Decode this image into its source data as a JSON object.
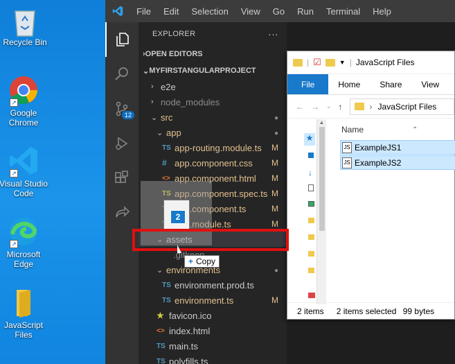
{
  "desktop": {
    "icons": [
      {
        "label": "Recycle Bin"
      },
      {
        "label": "Google Chrome"
      },
      {
        "label": "Visual Studio Code"
      },
      {
        "label": "Microsoft Edge"
      },
      {
        "label": "JavaScript Files"
      }
    ]
  },
  "vscode": {
    "menu": [
      "File",
      "Edit",
      "Selection",
      "View",
      "Go",
      "Run",
      "Terminal",
      "Help"
    ],
    "scm_badge": "12",
    "explorer_title": "EXPLORER",
    "more_actions": "···",
    "open_editors": "OPEN EDITORS",
    "project": "MYFIRSTANGULARPROJECT",
    "tree": {
      "e2e": "e2e",
      "node_modules": "node_modules",
      "src": "src",
      "app": "app",
      "app_routing": "app-routing.module.ts",
      "app_css": "app.component.css",
      "app_html": "app.component.html",
      "app_spec": "app.component.spec.ts",
      "app_ts": "app.component.ts",
      "app_module": "app.module.ts",
      "assets": "assets",
      "gitkeep": ".gitkeep",
      "environments": "environments",
      "env_prod": "environment.prod.ts",
      "env": "environment.ts",
      "favicon": "favicon.ico",
      "index": "index.html",
      "main": "main.ts",
      "polyfills": "polyfills.ts"
    },
    "modified_mark": "M"
  },
  "file_explorer": {
    "title": "JavaScript Files",
    "tabs": [
      "File",
      "Home",
      "Share",
      "View"
    ],
    "path": "JavaScript Files",
    "column_name": "Name",
    "files": [
      "ExampleJS1",
      "ExampleJS2"
    ],
    "status_items": "2 items",
    "status_selected": "2 items selected",
    "status_size": "99 bytes"
  },
  "drag": {
    "count": "2",
    "tooltip": "Copy"
  }
}
